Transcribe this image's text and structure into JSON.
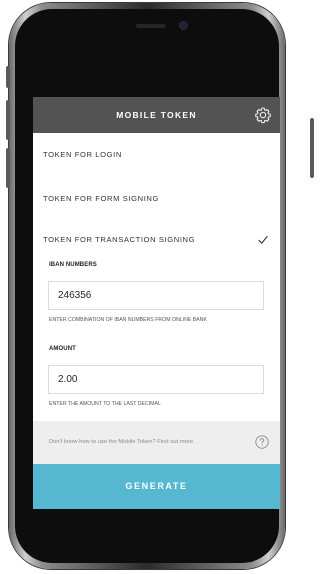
{
  "header": {
    "title": "MOBILE TOKEN",
    "settings_icon": "gear-icon"
  },
  "menu": {
    "items": [
      {
        "label": "TOKEN FOR LOGIN",
        "selected": false
      },
      {
        "label": "TOKEN FOR FORM SIGNING",
        "selected": false
      },
      {
        "label": "TOKEN FOR TRANSACTION SIGNING",
        "selected": true
      }
    ]
  },
  "form": {
    "iban": {
      "label": "IBAN NUMBERS",
      "value": "246356",
      "hint": "ENTER COMBINATION OF IBAN NUMBERS FROM ONLINE BANK"
    },
    "amount": {
      "label": "AMOUNT",
      "value": "2.00",
      "hint": "ENTER THE AMOUNT TO THE LAST DECIMAL"
    }
  },
  "help": {
    "text": "Don't know how to use the Mobile Token? Find out more.",
    "icon": "question-circle-icon"
  },
  "generate": {
    "label": "GENERATE"
  },
  "colors": {
    "header_bg": "#535353",
    "accent": "#55b7d0",
    "help_bar_bg": "#eeeeee"
  }
}
